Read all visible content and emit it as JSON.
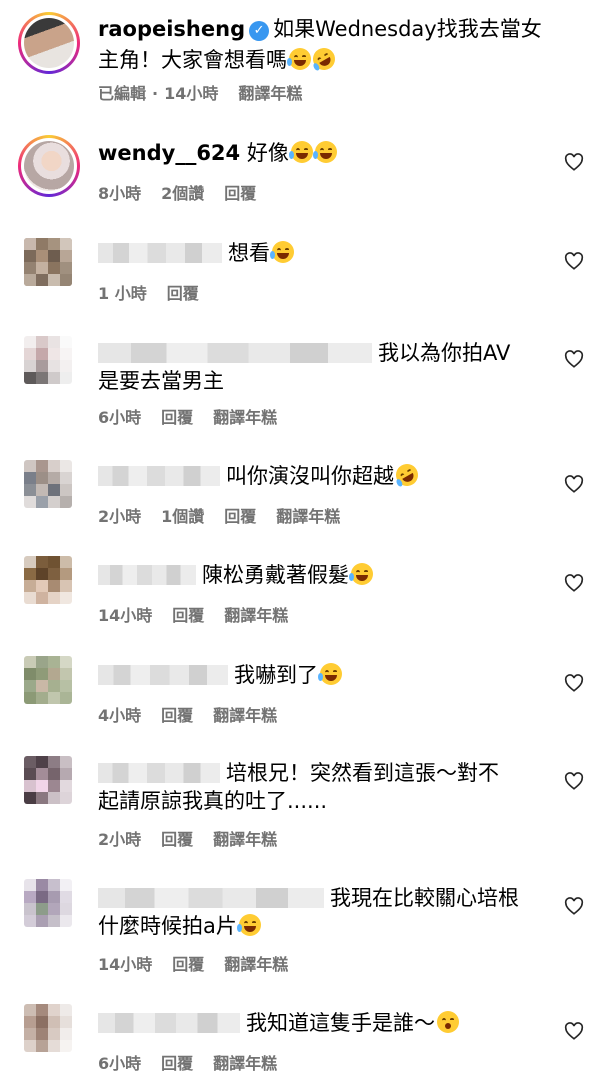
{
  "caption": {
    "username": "raopeisheng",
    "text_line1": "如果Wednesday找我去當女",
    "text_line2": "主角！大家會想看嗎",
    "edited": "已編輯",
    "dot": "·",
    "time": "14小時",
    "translate": "翻譯年糕"
  },
  "comments": [
    {
      "username": "wendy__624",
      "text": "好像",
      "time": "8小時",
      "likes": "2個讚",
      "reply": "回覆"
    },
    {
      "text": "想看",
      "time": "1 小時",
      "reply": "回覆"
    },
    {
      "text1": "我以為你拍AV",
      "text2": "是要去當男主",
      "time": "6小時",
      "reply": "回覆",
      "translate": "翻譯年糕"
    },
    {
      "text": "叫你演沒叫你超越",
      "time": "2小時",
      "likes": "1個讚",
      "reply": "回覆",
      "translate": "翻譯年糕"
    },
    {
      "text": "陳松勇戴著假髮",
      "time": "14小時",
      "reply": "回覆",
      "translate": "翻譯年糕"
    },
    {
      "text": "我嚇到了",
      "time": "4小時",
      "reply": "回覆",
      "translate": "翻譯年糕"
    },
    {
      "text1": "培根兄！突然看到這張～對不",
      "text2": "起請原諒我真的吐了......",
      "time": "2小時",
      "reply": "回覆",
      "translate": "翻譯年糕"
    },
    {
      "text1": "我現在比較關心培根",
      "text2": "什麼時候拍a片",
      "time": "14小時",
      "reply": "回覆",
      "translate": "翻譯年糕"
    },
    {
      "text": "我知道這隻手是誰～",
      "time": "6小時",
      "reply": "回覆",
      "translate": "翻譯年糕"
    }
  ],
  "colors": {
    "meta": "#737373",
    "verified": "#3897f0",
    "ring_start": "#f9ce34",
    "ring_mid": "#ee2a7b"
  }
}
